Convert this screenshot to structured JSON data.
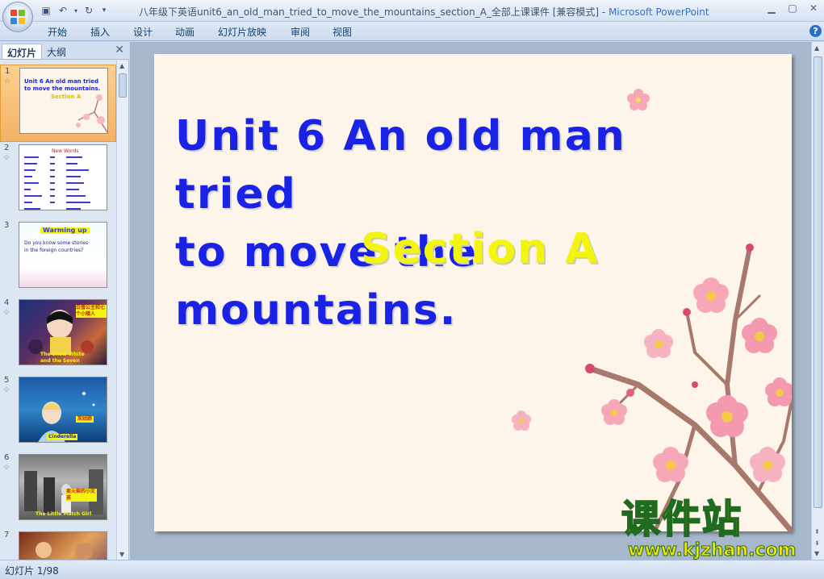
{
  "window": {
    "title": "八年级下英语unit6_an_old_man_tried_to_move_the_mountains_section_A_全部上课课件 [兼容模式] - ",
    "app_name": "Microsoft PowerPoint"
  },
  "ribbon": {
    "tabs": [
      "开始",
      "插入",
      "设计",
      "动画",
      "幻灯片放映",
      "审阅",
      "视图"
    ],
    "help": "?"
  },
  "panel": {
    "tabs": [
      "幻灯片",
      "大纲"
    ],
    "close": "✕"
  },
  "thumbnails": [
    {
      "num": "1",
      "line1": "Unit 6  An old man tried",
      "line2": "to move the mountains.",
      "line3": "Section A"
    },
    {
      "num": "2",
      "heading": "New Words"
    },
    {
      "num": "3",
      "banner": "Warming up",
      "line1": "Do you know some stories",
      "line2": "in the foreign countries?"
    },
    {
      "num": "4",
      "label1": "白雪公主和七个小矮人",
      "label2": "The Snow White and the Seven Dwarfs"
    },
    {
      "num": "5",
      "label1": "灰姑娘",
      "label2": "Cinderella"
    },
    {
      "num": "6",
      "label1": "卖火柴的小女孩",
      "label2": "The Little Match Girl"
    },
    {
      "num": "7"
    }
  ],
  "slide": {
    "title_line1": "Unit 6  An old man tried",
    "title_line2": "to move the mountains.",
    "subtitle": "Section A"
  },
  "watermark": {
    "cn": "课件站",
    "url": "www.kjzhan.com"
  },
  "status": {
    "slide_counter": "幻灯片 1/98"
  },
  "colors": {
    "title_blue": "#1a22e6",
    "section_yellow": "#f4f411",
    "slide_bg": "#fdf4ea",
    "selected_thumb": "#f4b264"
  }
}
